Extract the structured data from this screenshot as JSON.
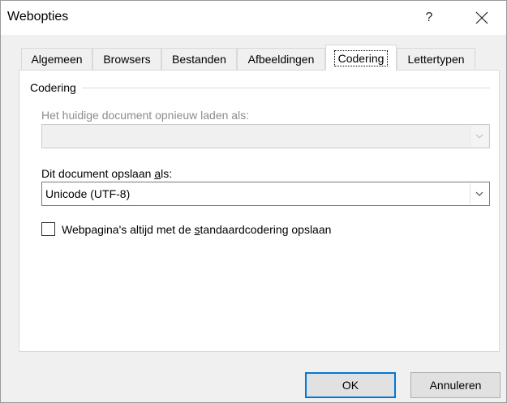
{
  "window": {
    "title": "Webopties",
    "help_label": "?"
  },
  "tabs": [
    {
      "label": "Algemeen",
      "active": false
    },
    {
      "label": "Browsers",
      "active": false
    },
    {
      "label": "Bestanden",
      "active": false
    },
    {
      "label": "Afbeeldingen",
      "active": false
    },
    {
      "label": "Codering",
      "active": true
    },
    {
      "label": "Lettertypen",
      "active": false
    }
  ],
  "encoding": {
    "group_label": "Codering",
    "reload_label": "Het huidige document opnieuw laden als:",
    "reload_value": "",
    "save_label_pre": "Dit document opslaan ",
    "save_label_accel": "a",
    "save_label_post": "ls:",
    "save_value": "Unicode (UTF-8)",
    "default_checkbox": {
      "checked": false,
      "label_pre": "Webpagina's altijd met de ",
      "label_accel": "s",
      "label_post": "tandaardcodering opslaan"
    }
  },
  "buttons": {
    "ok": "OK",
    "cancel": "Annuleren"
  },
  "colors": {
    "dialog_bg": "#f0f0f0",
    "default_button_border": "#0078d7",
    "disabled_text": "#8c8c8c"
  }
}
